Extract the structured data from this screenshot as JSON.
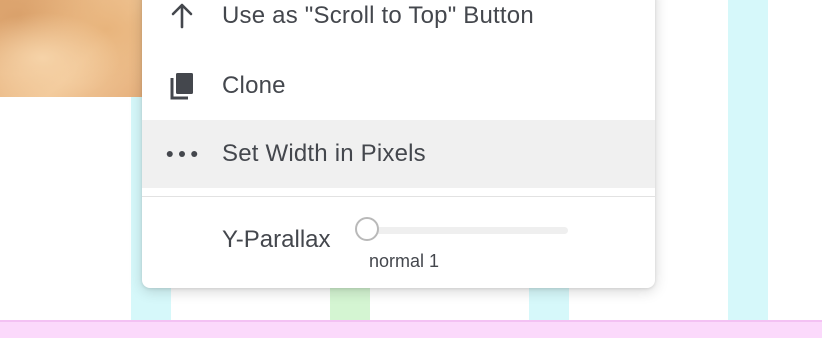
{
  "menu": {
    "items": [
      {
        "icon": "arrow-up-icon",
        "label": "Use as \"Scroll to Top\" Button"
      },
      {
        "icon": "clone-icon",
        "label": "Clone"
      },
      {
        "icon": "more-horizontal-icon",
        "label": "Set Width in Pixels"
      }
    ],
    "parallax": {
      "label": "Y-Parallax",
      "value_text": "normal 1",
      "value": 0
    }
  },
  "colors": {
    "text": "#44474d",
    "hover_bg": "#f0f0f0",
    "guide_cyan": "#d6f8fa",
    "guide_green": "#d4f5d2",
    "bottom_band": "#fbd9fb"
  }
}
